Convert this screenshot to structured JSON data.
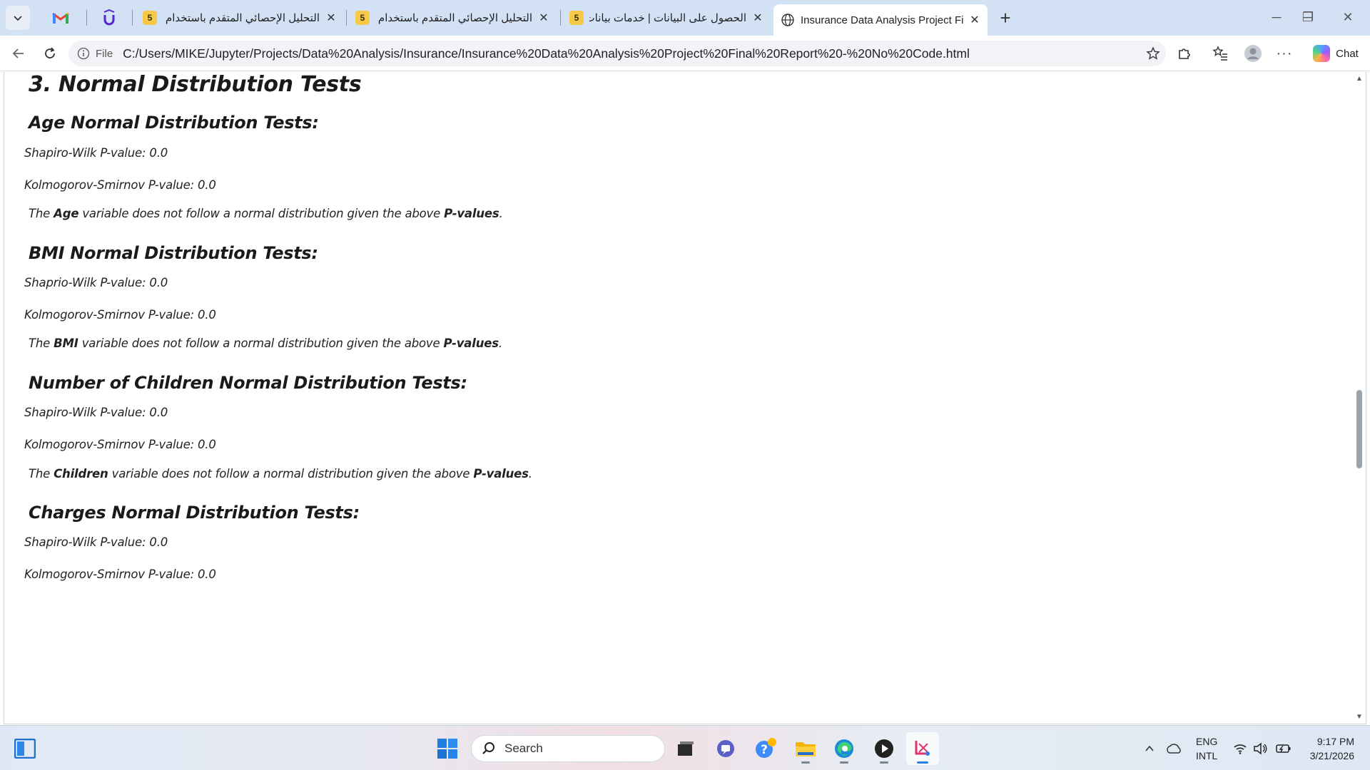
{
  "browser": {
    "tabs": [
      {
        "title": "التحليل الإحصائي المتقدم باستخدام n",
        "favicon": "5"
      },
      {
        "title": "التحليل الإحصائي المتقدم باستخدام R",
        "favicon": "5"
      },
      {
        "title": "الحصول على البيانات | خدمات بيانات",
        "favicon": "5"
      },
      {
        "title": "Insurance Data Analysis Project Final Report - No Code",
        "favicon": "globe-icon",
        "active": true
      }
    ],
    "address": {
      "scheme": "File",
      "url": "C:/Users/MIKE/Jupyter/Projects/Data%20Analysis/Insurance/Insurance%20Data%20Analysis%20Project%20Final%20Report%20-%20No%20Code.html"
    },
    "chat_label": "Chat"
  },
  "document": {
    "section_title": "3. Normal Distribution Tests",
    "subsections": [
      {
        "heading": "Age Normal Distribution Tests:",
        "tests": [
          "Shapiro-Wilk P-value: 0.0",
          "Kolmogorov-Smirnov P-value: 0.0"
        ],
        "conclusion": {
          "pre": "The ",
          "variable": "Age",
          "mid": " variable does not follow a normal distribution given the above ",
          "pvalues": "P-values",
          "post": "."
        }
      },
      {
        "heading": "BMI Normal Distribution Tests:",
        "tests": [
          "Shaprio-Wilk P-value: 0.0",
          "Kolmogorov-Smirnov P-value: 0.0"
        ],
        "conclusion": {
          "pre": "The ",
          "variable": "BMI",
          "mid": " variable does not follow a normal distribution given the above ",
          "pvalues": "P-values",
          "post": "."
        }
      },
      {
        "heading": "Number of Children Normal Distribution Tests:",
        "tests": [
          "Shapiro-Wilk P-value: 0.0",
          "Kolmogorov-Smirnov P-value: 0.0"
        ],
        "conclusion": {
          "pre": "The ",
          "variable": "Children",
          "mid": " variable does not follow a normal distribution given the above ",
          "pvalues": "P-values",
          "post": "."
        }
      },
      {
        "heading": "Charges Normal Distribution Tests:",
        "tests": [
          "Shapiro-Wilk P-value: 0.0",
          "Kolmogorov-Smirnov P-value: 0.0"
        ]
      }
    ]
  },
  "taskbar": {
    "search_placeholder": "Search",
    "language": {
      "line1": "ENG",
      "line2": "INTL"
    },
    "clock": {
      "time": "9:17 PM",
      "date": "3/21/2026"
    }
  },
  "colors": {
    "tab_strip": "#d3e1f4",
    "scroll_thumb": "#9aa3ad",
    "favicon": "#f7c948"
  }
}
